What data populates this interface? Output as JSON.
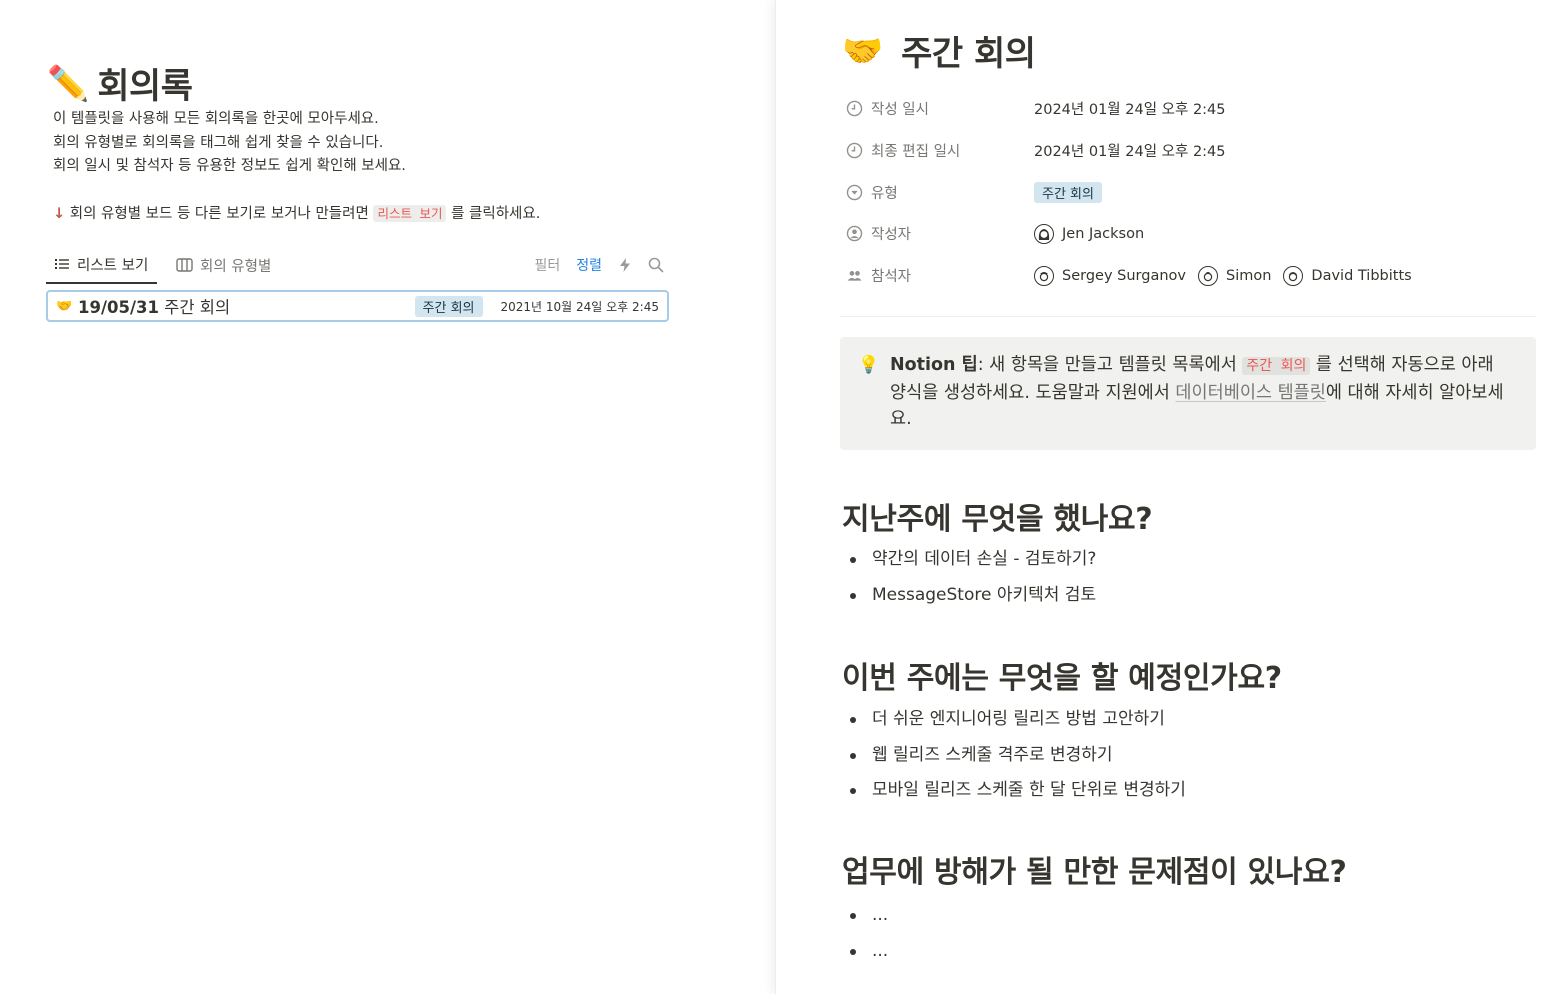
{
  "left": {
    "page_emoji": "✏️",
    "title": "회의록",
    "description": [
      "이 템플릿을 사용해 모든 회의록을 한곳에 모아두세요.",
      "회의 유형별로 회의록을 태그해 쉽게 찾을 수 있습니다.",
      "회의 일시 및 참석자 등 유용한 정보도 쉽게 확인해 보세요."
    ],
    "hint": {
      "arrow": "↓",
      "before": " 회의 유형별 보드 등 다른 보기로 보거나 만들려면 ",
      "code": "리스트 보기",
      "after": " 를 클릭하세요."
    },
    "tabs": [
      {
        "label": "리스트 보기",
        "icon": "list-icon",
        "active": true
      },
      {
        "label": "회의 유형별",
        "icon": "board-icon",
        "active": false
      }
    ],
    "toolbar": {
      "filter": "필터",
      "sort": "정렬",
      "automation_icon": "lightning-icon",
      "search_icon": "search-icon"
    },
    "rows": [
      {
        "emoji": "🤝",
        "date_prefix": "19/05/31",
        "title": " 주간 회의",
        "tag": "주간 회의",
        "created": "2021년 10월 24일 오후 2:45"
      }
    ]
  },
  "right": {
    "emoji": "🤝",
    "title": "주간 회의",
    "properties": [
      {
        "key": "작성 일시",
        "icon": "clock-icon",
        "value": "2024년 01월 24일 오후 2:45"
      },
      {
        "key": "최종 편집 일시",
        "icon": "clock-icon",
        "value": "2024년 01월 24일 오후 2:45"
      },
      {
        "key": "유형",
        "icon": "select-icon",
        "value": "주간 회의"
      },
      {
        "key": "작성자",
        "icon": "person-icon",
        "people": [
          "Jen Jackson"
        ]
      },
      {
        "key": "참석자",
        "icon": "people-icon",
        "people": [
          "Sergey Surganov",
          "Simon",
          "David Tibbitts"
        ]
      }
    ],
    "callout": {
      "icon": "💡",
      "bold": "Notion 팁",
      "t1": ": 새 항목을 만들고 템플릿 목록에서 ",
      "code": "주간 회의",
      "t2": " 를 선택해 자동으로 아래 양식을 생성하세요. 도움말과 지원에서 ",
      "link": "데이터베이스 템플릿",
      "t3": "에 대해 자세히 알아보세요."
    },
    "sections": [
      {
        "heading": "지난주에 무엇을 했나요?",
        "items": [
          "약간의 데이터 손실 - 검토하기?",
          "MessageStore 아키텍처 검토"
        ]
      },
      {
        "heading": "이번 주에는 무엇을 할 예정인가요?",
        "items": [
          "더 쉬운 엔지니어링 릴리즈 방법 고안하기",
          "웹 릴리즈 스케줄 격주로 변경하기",
          "모바일 릴리즈 스케줄 한 달 단위로 변경하기"
        ]
      },
      {
        "heading": "업무에 방해가 될 만한 문제점이 있나요?",
        "items": [
          "...",
          "..."
        ]
      }
    ]
  }
}
